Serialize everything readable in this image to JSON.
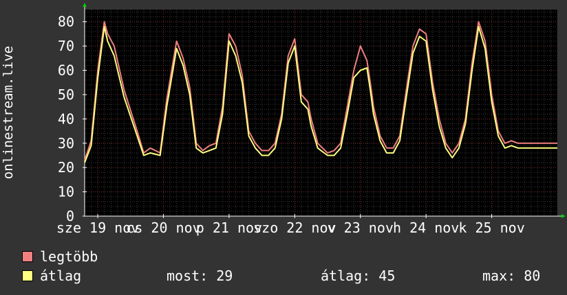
{
  "chart_data": {
    "type": "line",
    "ylabel": "onlinestream.live",
    "ylim": [
      0,
      85
    ],
    "yticks": [
      0,
      10,
      20,
      30,
      40,
      50,
      60,
      70,
      80
    ],
    "xlim": [
      0,
      7.2
    ],
    "xticks": [
      {
        "x": 0.2,
        "label": "sze 19 nov"
      },
      {
        "x": 1.2,
        "label": "cs 20 nov"
      },
      {
        "x": 2.2,
        "label": "p 21 nov"
      },
      {
        "x": 3.2,
        "label": "szo 22 nov"
      },
      {
        "x": 4.2,
        "label": "v 23 nov"
      },
      {
        "x": 5.2,
        "label": "h 24 nov"
      },
      {
        "x": 6.2,
        "label": "k 25 nov"
      }
    ],
    "grid": true,
    "series": [
      {
        "name": "legtöbb",
        "color": "#f08080",
        "x": [
          0,
          0.1,
          0.2,
          0.3,
          0.35,
          0.45,
          0.6,
          0.8,
          0.9,
          1.0,
          1.15,
          1.25,
          1.4,
          1.5,
          1.6,
          1.7,
          1.8,
          1.9,
          2.0,
          2.1,
          2.2,
          2.3,
          2.4,
          2.5,
          2.6,
          2.7,
          2.8,
          2.9,
          3.0,
          3.1,
          3.2,
          3.3,
          3.4,
          3.45,
          3.55,
          3.7,
          3.8,
          3.9,
          4.0,
          4.1,
          4.2,
          4.3,
          4.35,
          4.4,
          4.5,
          4.6,
          4.7,
          4.8,
          4.9,
          5.0,
          5.1,
          5.2,
          5.3,
          5.4,
          5.5,
          5.6,
          5.7,
          5.8,
          5.9,
          6.0,
          6.1,
          6.2,
          6.3,
          6.4,
          6.5,
          6.6,
          6.7,
          6.8,
          6.9,
          7.0,
          7.1,
          7.2
        ],
        "values": [
          23,
          31,
          60,
          80,
          75,
          70,
          52,
          35,
          26,
          28,
          26,
          48,
          72,
          65,
          53,
          30,
          27,
          29,
          30,
          45,
          75,
          70,
          58,
          35,
          30,
          27,
          27,
          30,
          42,
          66,
          73,
          50,
          47,
          40,
          30,
          26,
          27,
          30,
          45,
          60,
          70,
          64,
          55,
          45,
          33,
          28,
          28,
          33,
          52,
          70,
          77,
          75,
          55,
          40,
          30,
          26,
          30,
          40,
          63,
          80,
          72,
          50,
          35,
          30,
          31,
          30,
          30,
          30,
          30,
          30,
          30,
          30
        ]
      },
      {
        "name": "átlag",
        "color": "#ffff80",
        "x": [
          0,
          0.1,
          0.2,
          0.3,
          0.35,
          0.45,
          0.6,
          0.8,
          0.9,
          1.0,
          1.15,
          1.25,
          1.4,
          1.5,
          1.6,
          1.7,
          1.8,
          1.9,
          2.0,
          2.1,
          2.2,
          2.3,
          2.4,
          2.5,
          2.6,
          2.7,
          2.8,
          2.9,
          3.0,
          3.1,
          3.2,
          3.3,
          3.4,
          3.45,
          3.55,
          3.7,
          3.8,
          3.9,
          4.0,
          4.1,
          4.2,
          4.3,
          4.35,
          4.4,
          4.5,
          4.6,
          4.7,
          4.8,
          4.9,
          5.0,
          5.1,
          5.2,
          5.3,
          5.4,
          5.5,
          5.6,
          5.7,
          5.8,
          5.9,
          6.0,
          6.1,
          6.2,
          6.3,
          6.4,
          6.5,
          6.6,
          6.7,
          6.8,
          6.9,
          7.0,
          7.1,
          7.2
        ],
        "values": [
          22,
          29,
          57,
          78,
          72,
          66,
          49,
          33,
          25,
          26,
          25,
          45,
          69,
          62,
          50,
          28,
          26,
          27,
          28,
          42,
          72,
          66,
          55,
          33,
          28,
          25,
          25,
          28,
          40,
          63,
          70,
          47,
          44,
          37,
          28,
          25,
          25,
          28,
          42,
          57,
          60,
          61,
          52,
          42,
          31,
          26,
          26,
          31,
          49,
          67,
          74,
          72,
          52,
          37,
          28,
          24,
          28,
          38,
          60,
          78,
          69,
          47,
          33,
          28,
          29,
          28,
          28,
          28,
          28,
          28,
          28,
          28
        ]
      }
    ]
  },
  "legend": [
    {
      "label": "legtöbb",
      "color": "#f08080"
    },
    {
      "label": "átlag",
      "color": "#ffff80"
    }
  ],
  "stats": {
    "most": "most: 29",
    "atlag": "átlag: 45",
    "max": "max: 80"
  }
}
